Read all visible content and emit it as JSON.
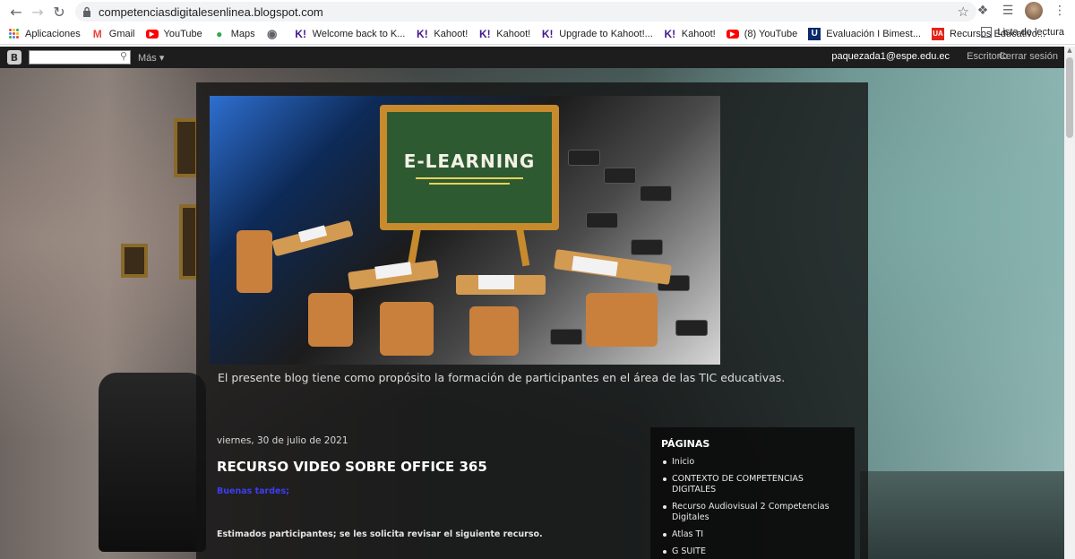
{
  "browser": {
    "url": "competenciasdigitalesenlinea.blogspot.com",
    "bookmarks": [
      {
        "label": "Aplicaciones",
        "icon": "apps-grid-icon"
      },
      {
        "label": "Gmail",
        "icon": "gmail-icon"
      },
      {
        "label": "YouTube",
        "icon": "youtube-icon"
      },
      {
        "label": "Maps",
        "icon": "maps-icon"
      },
      {
        "label": "",
        "icon": "globe-icon"
      },
      {
        "label": "Welcome back to K...",
        "icon": "kahoot-icon"
      },
      {
        "label": "Kahoot!",
        "icon": "kahoot-icon"
      },
      {
        "label": "Kahoot!",
        "icon": "kahoot-icon"
      },
      {
        "label": "Upgrade to Kahoot!...",
        "icon": "kahoot-icon"
      },
      {
        "label": "Kahoot!",
        "icon": "kahoot-icon"
      },
      {
        "label": "(8) YouTube",
        "icon": "youtube-icon"
      },
      {
        "label": "Evaluación I Bimest...",
        "icon": "u-icon"
      },
      {
        "label": "Recursos Educativo...",
        "icon": "ua-icon"
      }
    ],
    "reading_list": "Lista de lectura"
  },
  "navbar": {
    "more": "Más",
    "user_email": "paquezada1@espe.edu.ec",
    "dashboard": "Escritorio",
    "sign_out": "Cerrar sesión"
  },
  "header": {
    "board_text": "E-LEARNING",
    "description": "El presente blog tiene como propósito la formación de participantes en el área de las TIC educativas."
  },
  "post": {
    "date": "viernes, 30 de julio de 2021",
    "title": "RECURSO VIDEO SOBRE OFFICE 365",
    "greeting": "Buenas tardes;",
    "body": "Estimados  participantes; se les solicita revisar el siguiente recurso."
  },
  "sidebar": {
    "title": "PÁGINAS",
    "pages": [
      "Inicio",
      "CONTEXTO DE COMPETENCIAS DIGITALES",
      "Recurso Audiovisual 2 Competencias Digitales",
      "Atlas TI",
      "G SUITE"
    ]
  }
}
